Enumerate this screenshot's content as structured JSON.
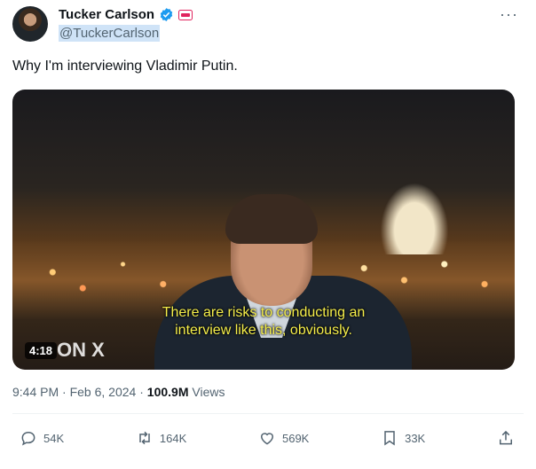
{
  "author": {
    "display_name": "Tucker Carlson",
    "handle": "@TuckerCarlson",
    "verified": true
  },
  "more_label": "···",
  "tweet_text": "Why I'm interviewing Vladimir Putin.",
  "media": {
    "caption_line1": "There are risks to conducting an",
    "caption_line2": "interview like this, obviously.",
    "duration": "4:18",
    "logo_text": "ON X"
  },
  "meta": {
    "time": "9:44 PM",
    "separator": "·",
    "date": "Feb 6, 2024",
    "views_count": "100.9M",
    "views_label": "Views"
  },
  "actions": {
    "replies": "54K",
    "reposts": "164K",
    "likes": "569K",
    "bookmarks": "33K"
  },
  "colors": {
    "verified_blue": "#1d9bf0",
    "handle_highlight": "#cfe3f7",
    "caption_yellow": "#f5ee4a"
  }
}
